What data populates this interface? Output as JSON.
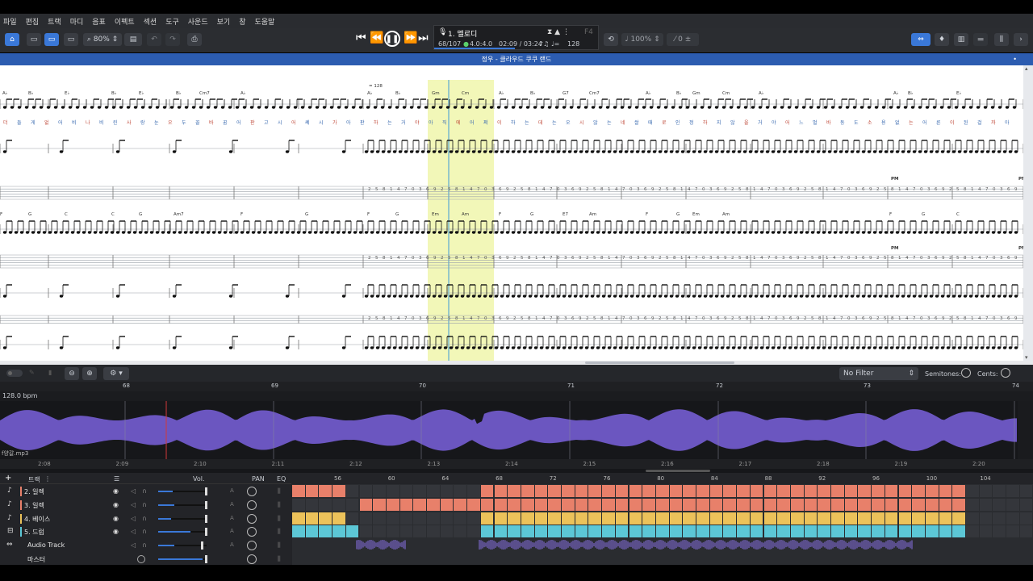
{
  "menu": [
    "파일",
    "편집",
    "트랙",
    "마디",
    "음표",
    "이펙트",
    "섹션",
    "도구",
    "사운드",
    "보기",
    "창",
    "도움말"
  ],
  "toolbar": {
    "zoom": "80%"
  },
  "lcd": {
    "track": "1. 멜로디",
    "bar_position": "68/107",
    "beat": "4.0:4.0",
    "time": "02:09 / 03:24",
    "tempo": "128",
    "key": "F4"
  },
  "score": {
    "title": "정우 - 클라우드 쿠쿠 랜드",
    "tempo_mark": "= 128",
    "pm": "PM",
    "chords_row1": [
      "A♭",
      "B♭",
      "E♭",
      "B♭",
      "E♭",
      "B♭",
      "Cm7",
      "A♭",
      "A♭",
      "B♭",
      "Gm",
      "Cm",
      "A♭",
      "B♭",
      "G7",
      "Cm7",
      "A♭",
      "B♭",
      "Gm",
      "Cm",
      "A♭",
      "A♭",
      "B♭",
      "E♭"
    ],
    "lyrics_row1": [
      "더",
      "들",
      "게",
      "없",
      "어",
      "비",
      "나",
      "비",
      "린",
      "사",
      "랑",
      "눈",
      "오",
      "두",
      "꼴",
      "바",
      "꿈",
      "어",
      "판",
      "고",
      "시",
      "어",
      "쎄",
      "시",
      "가",
      "아",
      "판",
      "하",
      "는",
      "거",
      "야",
      "아",
      "직",
      "에",
      "어",
      "쩌",
      "이",
      "하",
      "는",
      "데",
      "는",
      "오",
      "시",
      "않",
      "는",
      "네",
      "쌀",
      "때",
      "로",
      "인",
      "정",
      "하",
      "지",
      "않",
      "을",
      "거",
      "야",
      "어",
      "느",
      "벌",
      "바",
      "동",
      "도",
      "소",
      "용",
      "없",
      "는",
      "어",
      "른",
      "이",
      "된",
      "걸",
      "까",
      "아"
    ],
    "chords_row2": [
      "F",
      "G",
      "C",
      "C",
      "G",
      "Am7",
      "F",
      "G",
      "F",
      "G",
      "Em",
      "Am",
      "F",
      "G",
      "E7",
      "Am",
      "F",
      "G",
      "Em",
      "Am",
      "F",
      "G",
      "C"
    ]
  },
  "panel": {
    "filter": "No Filter",
    "semitones_label": "Semitones:",
    "cents_label": "Cents:"
  },
  "ruler_bars": [
    "68",
    "69",
    "70",
    "71",
    "72",
    "73",
    "74"
  ],
  "bpm_label": "128.0 bpm",
  "audio_file": "f양갈.mp3",
  "timeline": [
    "2:08",
    "2:09",
    "2:10",
    "2:11",
    "2:12",
    "2:13",
    "2:14",
    "2:15",
    "2:16",
    "2:17",
    "2:18",
    "2:19",
    "2:20"
  ],
  "tracks_header": {
    "title": "트랙",
    "vol": "Vol.",
    "pan": "PAN",
    "eq": "EQ"
  },
  "tracks": [
    {
      "name": "2. 일렉",
      "color": "#e8806a"
    },
    {
      "name": "3. 일렉",
      "color": "#e8806a"
    },
    {
      "name": "4. 베이스",
      "color": "#ecc25a"
    },
    {
      "name": "5. 드럼",
      "color": "#5cc7d6"
    },
    {
      "name": "Audio Track",
      "color": "#7a66c8"
    },
    {
      "name": "마스터",
      "color": "#aaaaaa"
    }
  ],
  "grid_bars": [
    "56",
    "60",
    "64",
    "68",
    "72",
    "76",
    "80",
    "84",
    "88",
    "92",
    "96",
    "100",
    "104"
  ],
  "colors": {
    "accent": "#3a78d8",
    "waveform": "#6b56c0",
    "highlight": "#f2f7b8",
    "title_bar": "#2c5cb0"
  }
}
